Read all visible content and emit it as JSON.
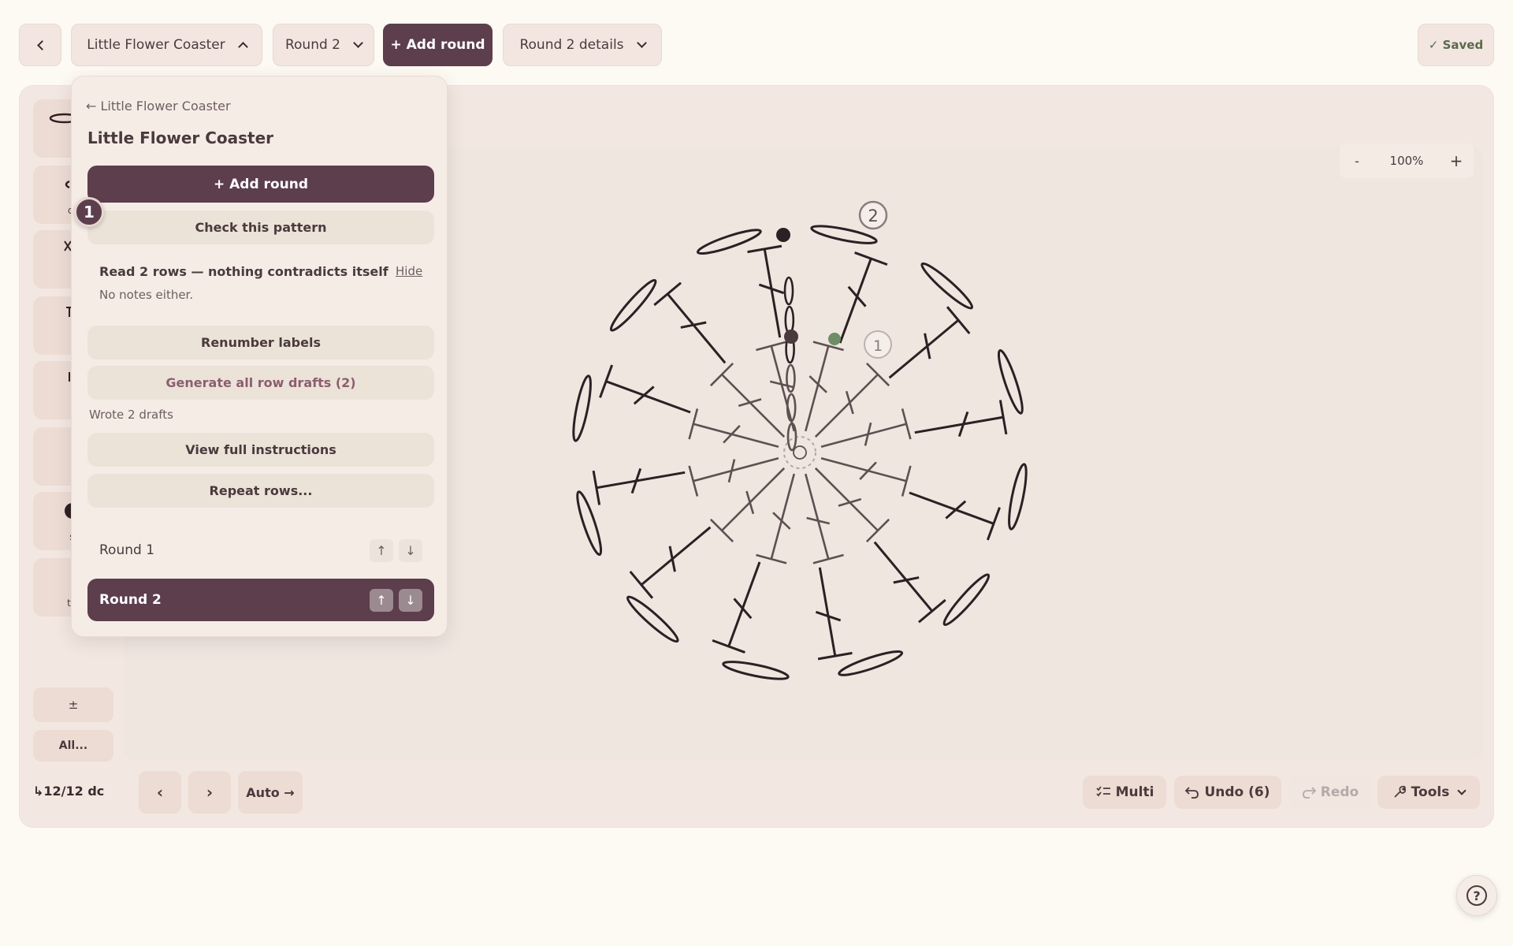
{
  "topbar": {
    "pattern_name": "Little Flower Coaster",
    "round_select": "Round 2",
    "add_round": "+ Add round",
    "round_details": "Round 2 details",
    "saved": "✓ Saved"
  },
  "dropdown": {
    "back_link": "← Little Flower Coaster",
    "title": "Little Flower Coaster",
    "add_round": "+ Add round",
    "check_pattern": "Check this pattern",
    "check_result": "Read 2 rows — nothing contradicts itself",
    "hide": "Hide",
    "no_notes": "No notes either.",
    "renumber": "Renumber labels",
    "generate": "Generate all row drafts (2)",
    "wrote": "Wrote 2 drafts",
    "view_instructions": "View full instructions",
    "repeat_rows": "Repeat rows...",
    "step_badge": "1",
    "rounds": [
      {
        "label": "Round 1",
        "up": "↑",
        "down": "↓"
      },
      {
        "label": "Round 2",
        "up": "↑",
        "down": "↓"
      }
    ]
  },
  "sidebar": {
    "tools": [
      "c",
      "ch",
      "s",
      "h",
      "c",
      "t",
      "sl",
      "t-c"
    ],
    "plusminus": "±",
    "all": "All..."
  },
  "zoom": {
    "minus": "-",
    "level": "100%",
    "plus": "+"
  },
  "chart": {
    "round_markers": [
      "1",
      "2"
    ],
    "stitch_color": "#2d2024",
    "inner_color": "#5e5050",
    "start_color": "#6d8e66"
  },
  "bottombar": {
    "progress": "↳12/12 dc",
    "prev": "‹",
    "next": "›",
    "auto": "Auto →",
    "multi": "Multi",
    "undo": "Undo (6)",
    "redo": "Redo",
    "tools": "Tools"
  },
  "help": "?"
}
